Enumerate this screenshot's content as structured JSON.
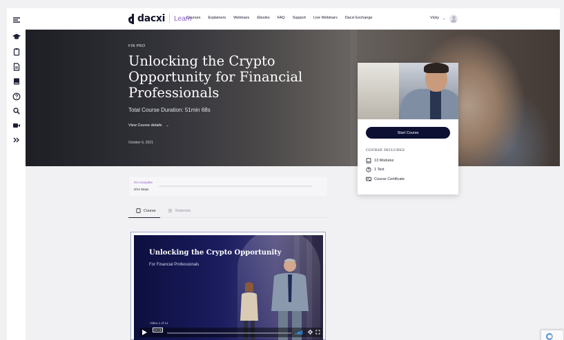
{
  "header": {
    "logo_text": "dacxi",
    "learn_label": "Learn",
    "nav": [
      "Courses",
      "Explainers",
      "Webinars",
      "Ebooks",
      "FAQ",
      "Support",
      "Live Webinars",
      "Dacxi Exchange"
    ],
    "user_name": "Vicky",
    "user_caret": "⌄"
  },
  "sidebar": {
    "icons": [
      "menu-icon",
      "graduation-cap-icon",
      "clipboard-icon",
      "document-icon",
      "book-icon",
      "help-icon",
      "search-icon",
      "video-icon",
      "expand-icon"
    ]
  },
  "hero": {
    "kicker": "FIN PRO",
    "title": "Unlocking the Crypto Opportunity for Financial Professionals",
    "duration": "Total Course Duration: 51min 68s",
    "details_label": "View Course details",
    "details_caret": "⌄",
    "date": "October 6, 2021"
  },
  "card": {
    "start_label": "Start Course",
    "includes_heading": "COURSE INCLUDES",
    "items": [
      {
        "icon": "book-icon",
        "label": "13 Modules"
      },
      {
        "icon": "question-icon",
        "label": "1 Test"
      },
      {
        "icon": "certificate-icon",
        "label": "Course Certificate"
      }
    ]
  },
  "progress": {
    "percent_label": "0% Complete",
    "steps_label": "0/14 Steps",
    "fraction": 0
  },
  "tabs": {
    "course_label": "Course",
    "materials_label": "Materials"
  },
  "video": {
    "title": "Unlocking the Crypto Opportunity",
    "subtitle": "For Financial Professionals",
    "counter": "Video 1 of 14",
    "time": "03:00"
  },
  "colors": {
    "accent": "#8e5ec8",
    "navy": "#0d1033"
  }
}
